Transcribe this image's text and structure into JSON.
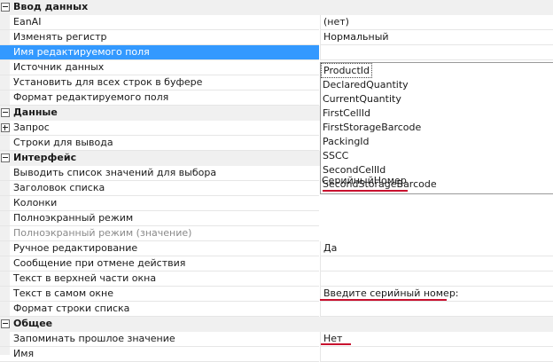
{
  "sections": {
    "data_input": "Ввод данных",
    "data": "Данные",
    "interface": "Интерфейс",
    "general": "Общее"
  },
  "props": {
    "eanai": {
      "name": "EanAI",
      "value": "(нет)"
    },
    "change_case": {
      "name": "Изменять регистр",
      "value": "Нормальный"
    },
    "edit_field_name": {
      "name": "Имя редактируемого поля",
      "value": ""
    },
    "data_source": {
      "name": "Источник данных"
    },
    "set_all_rows": {
      "name": "Установить для всех строк в буфере"
    },
    "edit_field_format": {
      "name": "Формат редактируемого поля"
    },
    "query": {
      "name": "Запрос"
    },
    "output_rows": {
      "name": "Строки для вывода"
    },
    "show_value_list": {
      "name": "Выводить список значений для выбора"
    },
    "list_header": {
      "name": "Заголовок списка"
    },
    "columns": {
      "name": "Колонки"
    },
    "fullscreen": {
      "name": "Полноэкранный режим"
    },
    "fullscreen_value": {
      "name": "Полноэкранный режим (значение)"
    },
    "manual_edit": {
      "name": "Ручное редактирование",
      "value": "Да"
    },
    "cancel_message": {
      "name": "Сообщение при отмене действия"
    },
    "top_text": {
      "name": "Текст в верхней части окна"
    },
    "window_text": {
      "name": "Текст в самом окне",
      "value": "Введите серийный номер:"
    },
    "list_row_format": {
      "name": "Формат строки списка"
    },
    "remember_last": {
      "name": "Запоминать прошлое значение",
      "value": "Нет"
    },
    "name": {
      "name": "Имя"
    }
  },
  "dropdown_options": [
    "ProductId",
    "DeclaredQuantity",
    "CurrentQuantity",
    "FirstCellId",
    "FirstStorageBarcode",
    "PackingId",
    "SSCC",
    "SecondCellId",
    "SecondStorageBarcode",
    "СерийныйНомер"
  ],
  "colors": {
    "selection": "#3399ff",
    "annotation_underline": "#c8102e",
    "section_bg": "#f0f0f0"
  }
}
